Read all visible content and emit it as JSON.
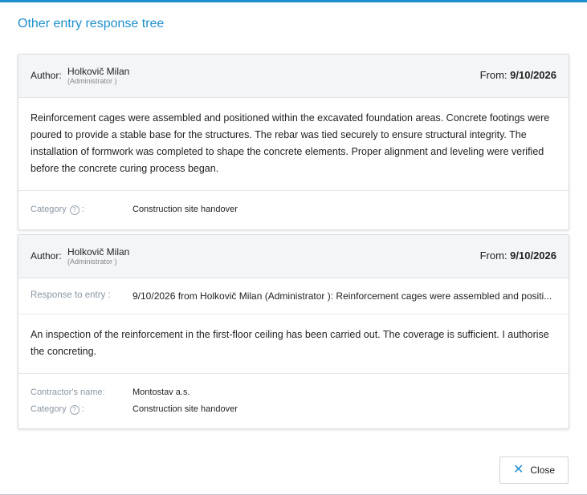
{
  "dialog": {
    "title": "Other entry response tree",
    "close_label": "Close",
    "close_icon": "close-icon"
  },
  "entries": [
    {
      "author_label": "Author:",
      "author_name": "Holkovič Milan",
      "author_role": "(Administrator )",
      "from_label": "From:",
      "date": "9/10/2026",
      "text": "Reinforcement cages were assembled and positioned within the excavated foundation areas. Concrete footings were poured to provide a stable base for the structures. The rebar was tied securely to ensure structural integrity. The installation of formwork was completed to shape the concrete elements. Proper alignment and leveling were verified before the concrete curing process began.",
      "category_label": "Category",
      "category_colon": ":",
      "category_value": "Construction site handover"
    },
    {
      "author_label": "Author:",
      "author_name": "Holkovič Milan",
      "author_role": "(Administrator )",
      "from_label": "From:",
      "date": "9/10/2026",
      "response_label": "Response to entry :",
      "response_value": "9/10/2026 from Holkovič Milan (Administrator ): Reinforcement cages were assembled and positi...",
      "text": "An inspection of the reinforcement in the first-floor ceiling has been carried out. The coverage is sufficient. I authorise the concreting.",
      "contractor_label": "Contractor's name:",
      "contractor_value": "Montostav a.s.",
      "category_label": "Category",
      "category_colon": ":",
      "category_value": "Construction site handover"
    }
  ]
}
